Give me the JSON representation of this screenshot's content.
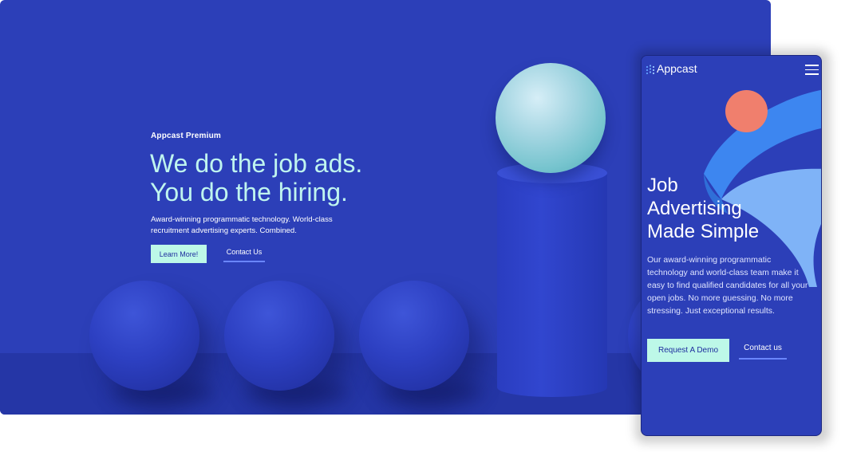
{
  "desktop": {
    "kicker": "Appcast Premium",
    "headline": [
      "We do the job ads.",
      "You do the hiring."
    ],
    "body": "Award-winning programmatic technology. World-class recruitment advertising experts. Combined.",
    "primary_button": "Learn More!",
    "secondary_link": "Contact Us"
  },
  "mobile": {
    "logo_text": "Appcast",
    "headline": [
      "Job",
      "Advertising",
      "Made Simple"
    ],
    "body": "Our award-winning programmatic technology and world-class team make it easy to find qualified candidates for all your open jobs. No more guessing. No more stressing. Just exceptional results.",
    "primary_button": "Request A Demo",
    "secondary_link": "Contact us"
  },
  "colors": {
    "background_blue": "#2c3fb8",
    "headline_mint": "#bff5ef",
    "button_mint": "#bdf8e8",
    "button_text": "#1f2e9e",
    "coral": "#f07f6d",
    "ribbon_blue": "#3d86f0",
    "link_underline": "#6a86ff"
  },
  "icons": [
    "appcast-logo-icon",
    "hamburger-menu-icon"
  ]
}
